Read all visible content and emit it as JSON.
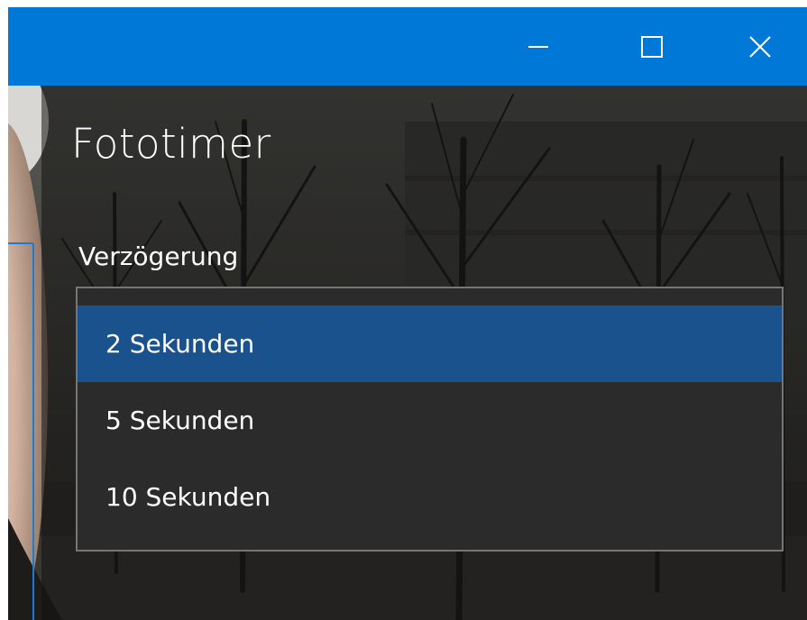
{
  "window": {
    "accent_color": "#0078d7",
    "caption_buttons": {
      "minimize_icon": "minimize-icon",
      "maximize_icon": "maximize-icon",
      "close_icon": "close-icon"
    }
  },
  "app": {
    "title": "Fototimer"
  },
  "delay": {
    "label": "Verzögerung",
    "selected_index": 0,
    "selected_color": "#19528c",
    "options": [
      {
        "label": "2 Sekunden"
      },
      {
        "label": "5 Sekunden"
      },
      {
        "label": "10 Sekunden"
      }
    ]
  }
}
